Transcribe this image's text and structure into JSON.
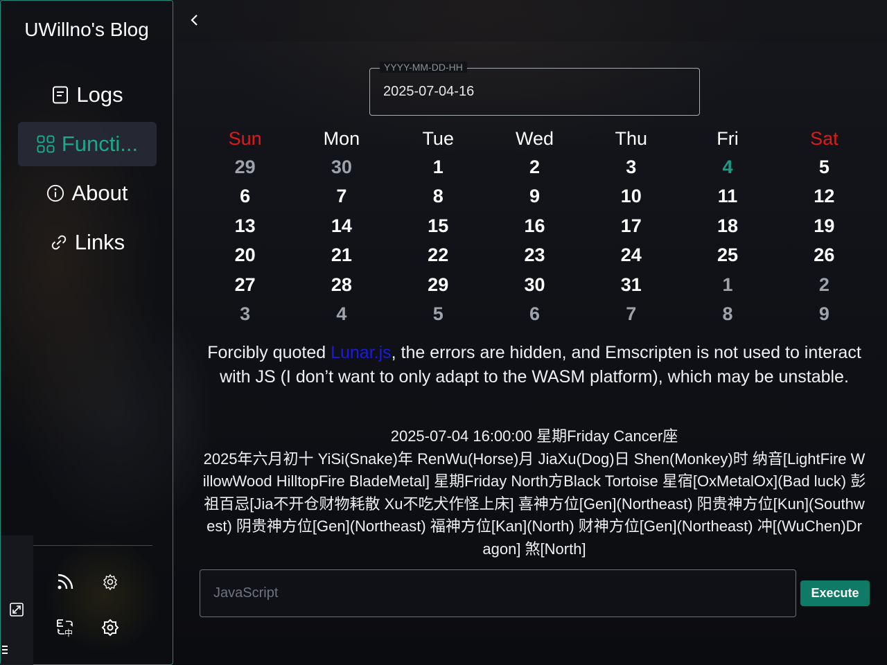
{
  "blog_title": "UWillno's Blog",
  "nav": [
    {
      "label": "Logs",
      "icon": "document-icon"
    },
    {
      "label": "Functi...",
      "icon": "apps-grid-icon",
      "active": true
    },
    {
      "label": "About",
      "icon": "info-icon"
    },
    {
      "label": "Links",
      "icon": "link-icon"
    }
  ],
  "tools": [
    "rss-icon",
    "settings-icon",
    "translate-icon",
    "settings-alt-icon",
    "expand-icon",
    "menu-icon"
  ],
  "date_field": {
    "label": "YYYY-MM-DD-HH",
    "value": "2025-07-04-16"
  },
  "calendar": {
    "weekdays": [
      "Sun",
      "Mon",
      "Tue",
      "Wed",
      "Thu",
      "Fri",
      "Sat"
    ],
    "weeks": [
      [
        "29",
        "30",
        "1",
        "2",
        "3",
        "4",
        "5"
      ],
      [
        "6",
        "7",
        "8",
        "9",
        "10",
        "11",
        "12"
      ],
      [
        "13",
        "14",
        "15",
        "16",
        "17",
        "18",
        "19"
      ],
      [
        "20",
        "21",
        "22",
        "23",
        "24",
        "25",
        "26"
      ],
      [
        "27",
        "28",
        "29",
        "30",
        "31",
        "1",
        "2"
      ],
      [
        "3",
        "4",
        "5",
        "6",
        "7",
        "8",
        "9"
      ]
    ],
    "today": "4",
    "colors": {
      "weekend": "#e0191a",
      "today": "#1a9b86",
      "muted": "#9ea2aa"
    }
  },
  "note": {
    "before": "Forcibly quoted ",
    "link": "Lunar.js",
    "after": ", the errors are hidden, and Emscripten is not used to interact with JS (I don’t want to only adapt to the WASM platform), which may be unstable."
  },
  "lunar": {
    "line1": "2025-07-04 16:00:00 星期Friday Cancer座",
    "line2": "2025年六月初十 YiSi(Snake)年 RenWu(Horse)月 JiaXu(Dog)日 Shen(Monkey)时 纳音[LightFire WillowWood HilltopFire BladeMetal] 星期Friday North方Black Tortoise 星宿[OxMetalOx](Bad luck) 彭祖百忌[Jia不开仓财物耗散 Xu不吃犬作怪上床] 喜神方位[Gen](Northeast) 阳贵神方位[Kun](Southwest) 阴贵神方位[Gen](Northeast) 福神方位[Kan](North) 财神方位[Gen](Northeast) 冲[(WuChen)Dragon] 煞[North]"
  },
  "js_console": {
    "placeholder": "JavaScript",
    "button": "Execute"
  },
  "accent": "#1a9b86"
}
